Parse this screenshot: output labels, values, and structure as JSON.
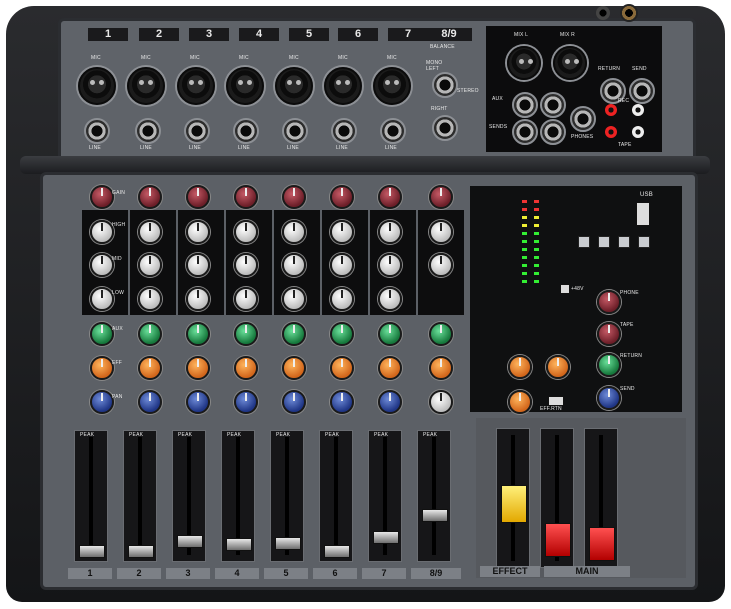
{
  "channels": [
    {
      "number": "1",
      "label": "1"
    },
    {
      "number": "2",
      "label": "2"
    },
    {
      "number": "3",
      "label": "3"
    },
    {
      "number": "4",
      "label": "4"
    },
    {
      "number": "5",
      "label": "5"
    },
    {
      "number": "6",
      "label": "6"
    },
    {
      "number": "7",
      "label": "7"
    },
    {
      "number": "8/9",
      "label": "8/9"
    }
  ],
  "labels": {
    "mic": "MIC",
    "line": "LINE",
    "balance": "BALANCE",
    "mono_left": "MONO\nLEFT",
    "right": "RIGHT",
    "gain": "GAIN",
    "high": "HIGH",
    "mid": "MID",
    "low": "LOW",
    "aux": "AUX",
    "eff": "EFF",
    "pan": "PAN",
    "peak": "PEAK",
    "phone": "PHONE",
    "tape": "TAPE",
    "return": "RETURN",
    "send": "SEND",
    "effect": "EFFECT",
    "main": "MAIN",
    "usb": "USB",
    "rec": "REC",
    "mix_l": "MIX L",
    "mix_r": "MIX R",
    "aux_label": "AUX",
    "sends": "SENDS",
    "phones": "PHONES",
    "ipwr": "EFF.RTN",
    "power": "+48V",
    "stereo": "STEREO"
  },
  "colors": {
    "panel": "#5c6066",
    "shell": "#1f2023",
    "knob_red": "#a13a46",
    "knob_white": "#f0f0f0",
    "knob_green": "#2fa95a",
    "knob_orange": "#f08a2a",
    "knob_blue": "#2d4aa8",
    "effect_fader": "#f0c000",
    "main_fader": "#e00000"
  }
}
